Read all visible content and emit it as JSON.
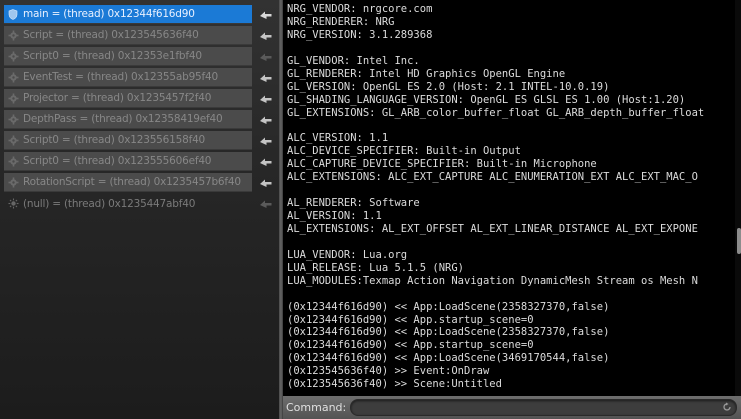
{
  "threads": [
    {
      "label": "main = (thread) 0x12344f616d90",
      "icon": "shield-icon",
      "selected": true
    },
    {
      "label": "Script = (thread) 0x123545636f40",
      "icon": "gear-icon",
      "selected": false
    },
    {
      "label": "Script0 = (thread) 0x12353e1fbf40",
      "icon": "gear-icon",
      "selected": false
    },
    {
      "label": "EventTest = (thread) 0x12355ab95f40",
      "icon": "gear-icon",
      "selected": false
    },
    {
      "label": "Projector = (thread) 0x1235457f2f40",
      "icon": "gear-icon",
      "selected": false
    },
    {
      "label": "DepthPass = (thread) 0x12358419ef40",
      "icon": "gear-icon",
      "selected": false
    },
    {
      "label": "Script0 = (thread) 0x123556158f40",
      "icon": "gear-icon",
      "selected": false
    },
    {
      "label": "Script0 = (thread) 0x123555606ef40",
      "icon": "gear-icon",
      "selected": false
    },
    {
      "label": "RotationScript = (thread) 0x1235457b6f40",
      "icon": "gear-icon",
      "selected": false
    },
    {
      "label": "(null) = (thread) 0x1235447abf40",
      "icon": "sun-icon",
      "selected": false
    }
  ],
  "console_lines": [
    "NRG_VENDOR: nrgcore.com",
    "NRG_RENDERER: NRG",
    "NRG_VERSION: 3.1.289368",
    "",
    "GL_VENDOR: Intel Inc.",
    "GL_RENDERER: Intel HD Graphics OpenGL Engine",
    "GL_VERSION: OpenGL ES 2.0 (Host: 2.1 INTEL-10.0.19)",
    "GL_SHADING_LANGUAGE_VERSION: OpenGL ES GLSL ES 1.00 (Host:1.20)",
    "GL_EXTENSIONS: GL_ARB_color_buffer_float GL_ARB_depth_buffer_float",
    "",
    "ALC_VERSION: 1.1",
    "ALC_DEVICE_SPECIFIER: Built-in Output",
    "ALC_CAPTURE_DEVICE_SPECIFIER: Built-in Microphone",
    "ALC_EXTENSIONS: ALC_EXT_CAPTURE ALC_ENUMERATION_EXT ALC_EXT_MAC_O",
    "",
    "AL_RENDERER: Software",
    "AL_VERSION: 1.1",
    "AL_EXTENSIONS: AL_EXT_OFFSET AL_EXT_LINEAR_DISTANCE AL_EXT_EXPONE",
    "",
    "LUA_VENDOR: Lua.org",
    "LUA_RELEASE: Lua 5.1.5 (NRG)",
    "LUA_MODULES:Texmap Action Navigation DynamicMesh Stream os Mesh N",
    "",
    "(0x12344f616d90) << App:LoadScene(2358327370,false)",
    "(0x12344f616d90) << App.startup_scene=0",
    "(0x12344f616d90) << App:LoadScene(2358327370,false)",
    "(0x12344f616d90) << App.startup_scene=0",
    "(0x12344f616d90) << App:LoadScene(3469170544,false)",
    "(0x123545636f40) >> Event:OnDraw",
    "(0x123545636f40) >> Scene:Untitled"
  ],
  "command": {
    "label": "Command:",
    "value": ""
  },
  "colors": {
    "selected": "#1b7ad6",
    "console_bg": "#000000",
    "console_text": "#dcdcdc"
  }
}
